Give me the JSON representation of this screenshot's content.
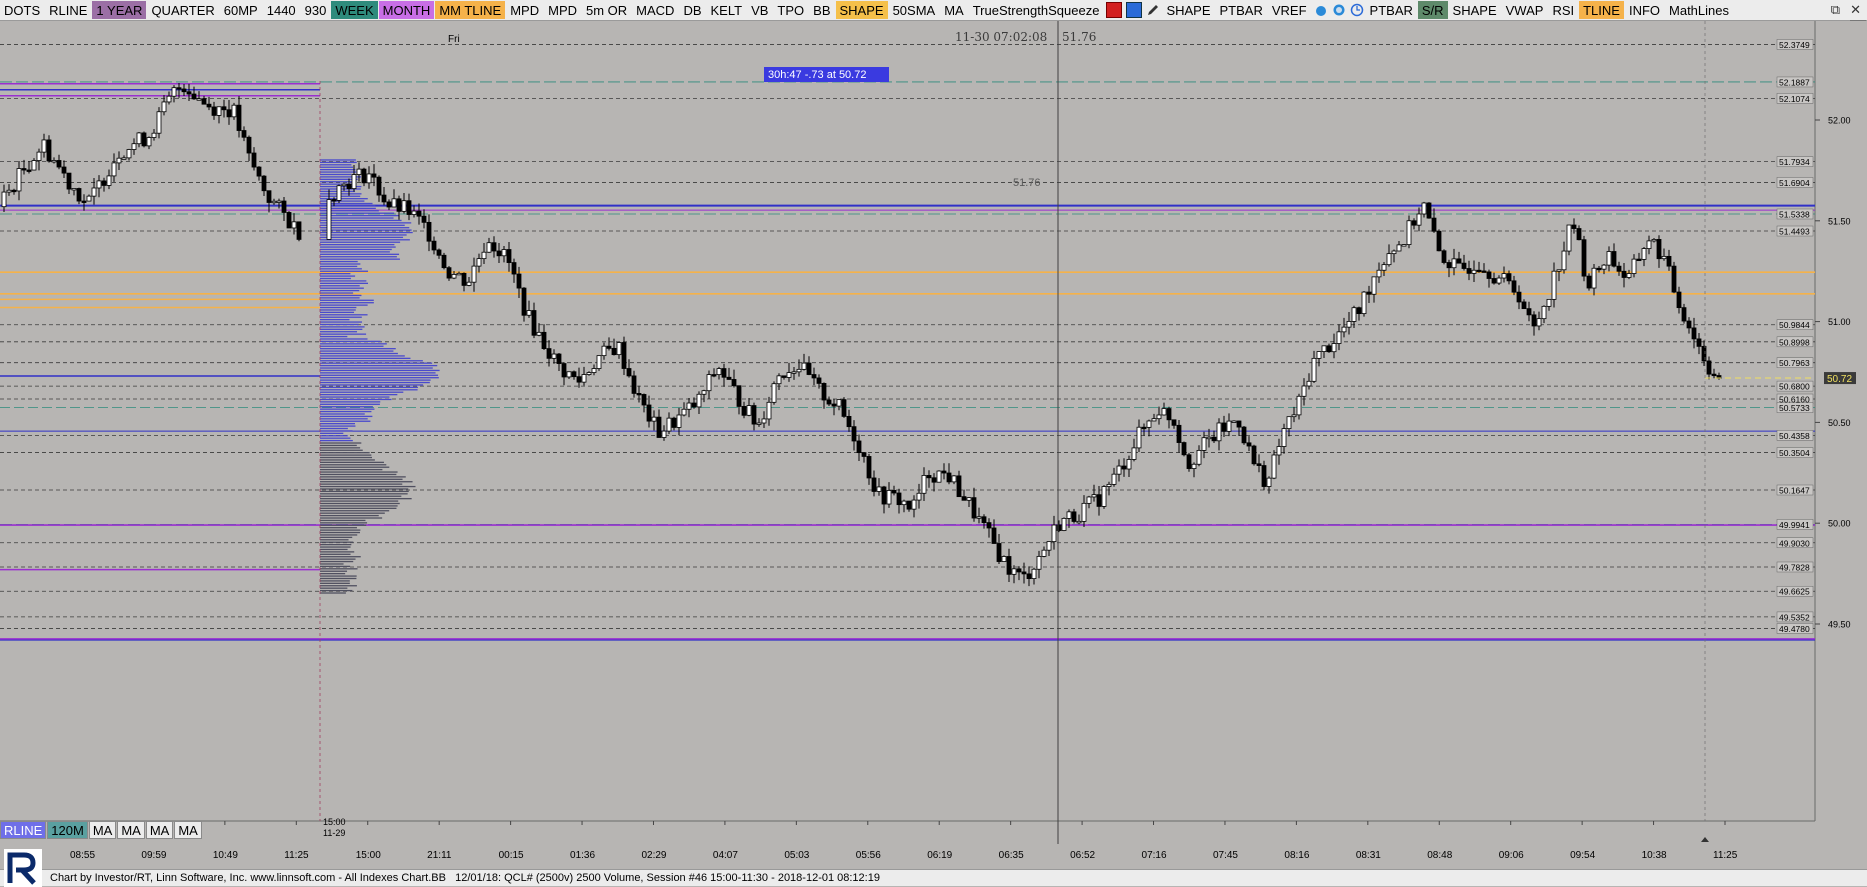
{
  "toolbar": {
    "items": [
      {
        "label": "DOTS",
        "bg": "#ececec",
        "fg": "#000"
      },
      {
        "label": "RLINE",
        "bg": "#ececec",
        "fg": "#000"
      },
      {
        "label": "1 YEAR",
        "bg": "#9b6fa5",
        "fg": "#000"
      },
      {
        "label": "QUARTER",
        "bg": "#ececec",
        "fg": "#000"
      },
      {
        "label": "60MP",
        "bg": "#ececec",
        "fg": "#000"
      },
      {
        "label": "1440",
        "bg": "#ececec",
        "fg": "#000"
      },
      {
        "label": "930",
        "bg": "#ececec",
        "fg": "#000"
      },
      {
        "label": "WEEK",
        "bg": "#2e8b7c",
        "fg": "#000"
      },
      {
        "label": "MONTH",
        "bg": "#c86ee6",
        "fg": "#000"
      },
      {
        "label": "MM TLINE",
        "bg": "#f5b24a",
        "fg": "#000"
      },
      {
        "label": "MPD",
        "bg": "#ececec",
        "fg": "#000"
      },
      {
        "label": "MPD",
        "bg": "#ececec",
        "fg": "#000"
      },
      {
        "label": "5m OR",
        "bg": "#ececec",
        "fg": "#000"
      },
      {
        "label": "MACD",
        "bg": "#ececec",
        "fg": "#000"
      },
      {
        "label": "DB",
        "bg": "#ececec",
        "fg": "#000"
      },
      {
        "label": "KELT",
        "bg": "#ececec",
        "fg": "#000"
      },
      {
        "label": "VB",
        "bg": "#ececec",
        "fg": "#000"
      },
      {
        "label": "TPO",
        "bg": "#ececec",
        "fg": "#000"
      },
      {
        "label": "BB",
        "bg": "#ececec",
        "fg": "#000"
      },
      {
        "label": "SHAPE",
        "bg": "#f5c04a",
        "fg": "#000"
      },
      {
        "label": "50SMA",
        "bg": "#ececec",
        "fg": "#000"
      },
      {
        "label": "MA",
        "bg": "#ececec",
        "fg": "#000"
      },
      {
        "label": "TrueStrengthSqueeze",
        "bg": "#ececec",
        "fg": "#000"
      }
    ],
    "items2": [
      {
        "label": "SHAPE",
        "bg": "#ececec",
        "fg": "#000"
      },
      {
        "label": "PTBAR",
        "bg": "#ececec",
        "fg": "#000"
      },
      {
        "label": "VREF",
        "bg": "#ececec",
        "fg": "#000"
      }
    ],
    "items3": [
      {
        "label": "PTBAR",
        "bg": "#ececec",
        "fg": "#000"
      },
      {
        "label": "S/R",
        "bg": "#5e8a6a",
        "fg": "#000"
      },
      {
        "label": "SHAPE",
        "bg": "#ececec",
        "fg": "#000"
      },
      {
        "label": "VWAP",
        "bg": "#ececec",
        "fg": "#000"
      },
      {
        "label": "RSI",
        "bg": "#ececec",
        "fg": "#000"
      },
      {
        "label": "TLINE",
        "bg": "#f5b24a",
        "fg": "#000"
      },
      {
        "label": "INFO",
        "bg": "#ececec",
        "fg": "#000"
      },
      {
        "label": "MathLines",
        "bg": "#ececec",
        "fg": "#000"
      }
    ],
    "icons": [
      "red-square-icon",
      "blue-square-icon",
      "pencil-icon"
    ],
    "icons2": [
      "drop-icon",
      "timer-icon",
      "clock-icon"
    ],
    "window_controls": [
      "restore-icon",
      "close-icon"
    ]
  },
  "header": {
    "day_label": "Fri",
    "cursor_time": "11-30 07:02:08",
    "cursor_price": "51.76",
    "info_box": "30h:47 -.73 at 50.72",
    "crosshair_price": "51.76"
  },
  "axis": {
    "price_ticks": [
      "52.00",
      "51.50",
      "51.00",
      "50.50",
      "50.00",
      "49.50"
    ],
    "level_labels": [
      "52.3749",
      "52.1887",
      "52.1074",
      "51.7934",
      "51.6904",
      "51.5338",
      "51.4493",
      "50.9844",
      "50.8998",
      "50.7963",
      "50.6800",
      "50.6160",
      "50.5733",
      "50.4358",
      "50.3504",
      "50.1647",
      "49.9941",
      "49.9030",
      "49.7828",
      "49.6625",
      "49.5352",
      "49.4780"
    ],
    "last_price": "50.72",
    "time_ticks": [
      "08:55",
      "09:59",
      "10:49",
      "11:25",
      "15:00",
      "21:11",
      "00:15",
      "01:36",
      "02:29",
      "04:07",
      "05:03",
      "05:56",
      "06:19",
      "06:35",
      "06:52",
      "07:16",
      "07:45",
      "08:16",
      "08:31",
      "08:48",
      "09:06",
      "09:54",
      "10:38",
      "11:25"
    ],
    "session_marker_time": "15:00",
    "session_marker_date": "11-29"
  },
  "bottom_buttons": [
    {
      "label": "RLINE",
      "bg": "#6f6fe8",
      "fg": "#fff"
    },
    {
      "label": "120M",
      "bg": "#5aa0a0",
      "fg": "#000"
    },
    {
      "label": "MA",
      "bg": "#ececec",
      "fg": "#000"
    },
    {
      "label": "MA",
      "bg": "#ececec",
      "fg": "#000"
    },
    {
      "label": "MA",
      "bg": "#ececec",
      "fg": "#000"
    },
    {
      "label": "MA",
      "bg": "#ececec",
      "fg": "#000"
    }
  ],
  "footer": {
    "credit": "Chart by Investor/RT, Linn Software, Inc. www.linnsoft.com - All Indexes Chart.BB",
    "session": "12/01/18: QCL# (2500v) 2500 Volume, Session #46 15:00-11:30 - 2018-12-01 08:12:19"
  },
  "colors": {
    "chart_bg": "#b7b5b3",
    "grid": "#a6a4a2",
    "dashed_level": "#3a3a3a",
    "teal_level": "#2e8b7c",
    "blue_level": "#3030c8",
    "purple_level": "#9a2fd0",
    "orange_level": "#f5b24a",
    "profile": "#4a4acc"
  }
}
